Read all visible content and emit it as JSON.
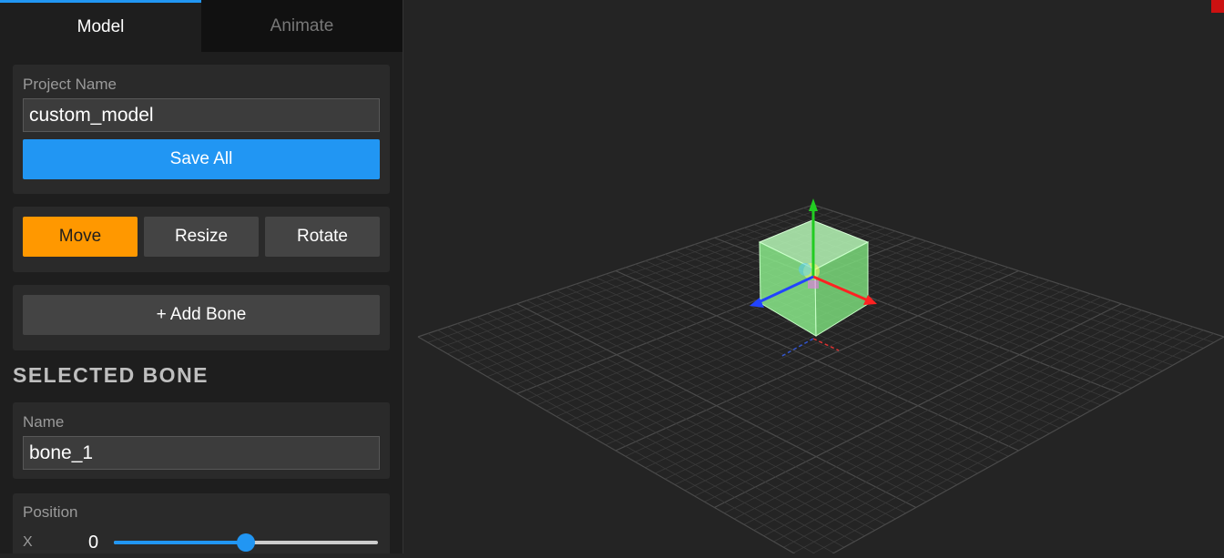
{
  "tabs": [
    {
      "label": "Model",
      "active": true
    },
    {
      "label": "Animate",
      "active": false
    }
  ],
  "project": {
    "label": "Project Name",
    "value": "custom_model",
    "save_label": "Save All"
  },
  "tools": {
    "move_label": "Move",
    "resize_label": "Resize",
    "rotate_label": "Rotate",
    "active": "Move"
  },
  "add_bone_label": "+ Add Bone",
  "selected_bone": {
    "heading": "SELECTED BONE",
    "name_label": "Name",
    "name_value": "bone_1",
    "position_label": "Position",
    "x_label": "X",
    "x_value": "0",
    "x_slider_fraction": 0.5
  },
  "viewport": {
    "object": "cube-bone",
    "cube_color": "#8ef08e",
    "axis_colors": {
      "x": "#ff2222",
      "y": "#22cc22",
      "z": "#2244ff"
    },
    "grid_color": "#3a3a3a"
  }
}
